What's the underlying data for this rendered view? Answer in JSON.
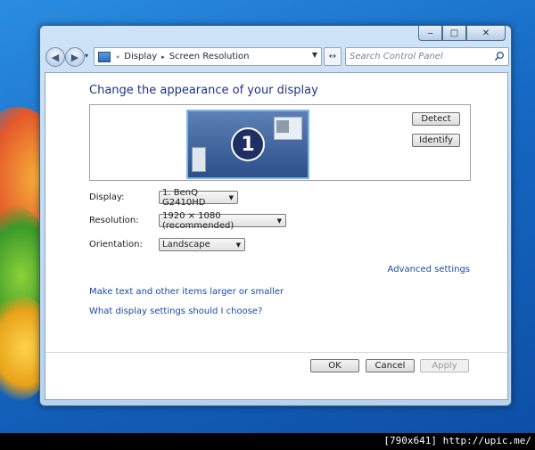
{
  "window": {
    "caption": {
      "minimize": "‒",
      "maximize": "□",
      "close": "✕"
    },
    "nav": {
      "back": "◀",
      "forward": "▶",
      "history": "▾"
    },
    "breadcrumb": [
      "Display",
      "Screen Resolution"
    ],
    "breadcrumb_prefix": "«",
    "breadcrumb_separator": "▸",
    "refresh": "↔",
    "search": {
      "placeholder": "Search Control Panel"
    }
  },
  "page": {
    "title": "Change the appearance of your display",
    "monitor_number": "1",
    "detect_label": "Detect",
    "identify_label": "Identify",
    "fields": {
      "display": {
        "label": "Display:",
        "value": "1. BenQ G2410HD"
      },
      "resolution": {
        "label": "Resolution:",
        "value": "1920 × 1080 (recommended)"
      },
      "orientation": {
        "label": "Orientation:",
        "value": "Landscape"
      }
    },
    "links": {
      "advanced": "Advanced settings",
      "text_size": "Make text and other items larger or smaller",
      "help": "What display settings should I choose?"
    },
    "buttons": {
      "ok": "OK",
      "cancel": "Cancel",
      "apply": "Apply"
    },
    "dropdown_arrow": "▼"
  },
  "footer": {
    "text": "[790x641] http://upic.me/"
  },
  "colors": {
    "title": "#1e3287",
    "link": "#1a4aa6",
    "monitor": "#3c5f98",
    "desktop": "#1669c4"
  }
}
